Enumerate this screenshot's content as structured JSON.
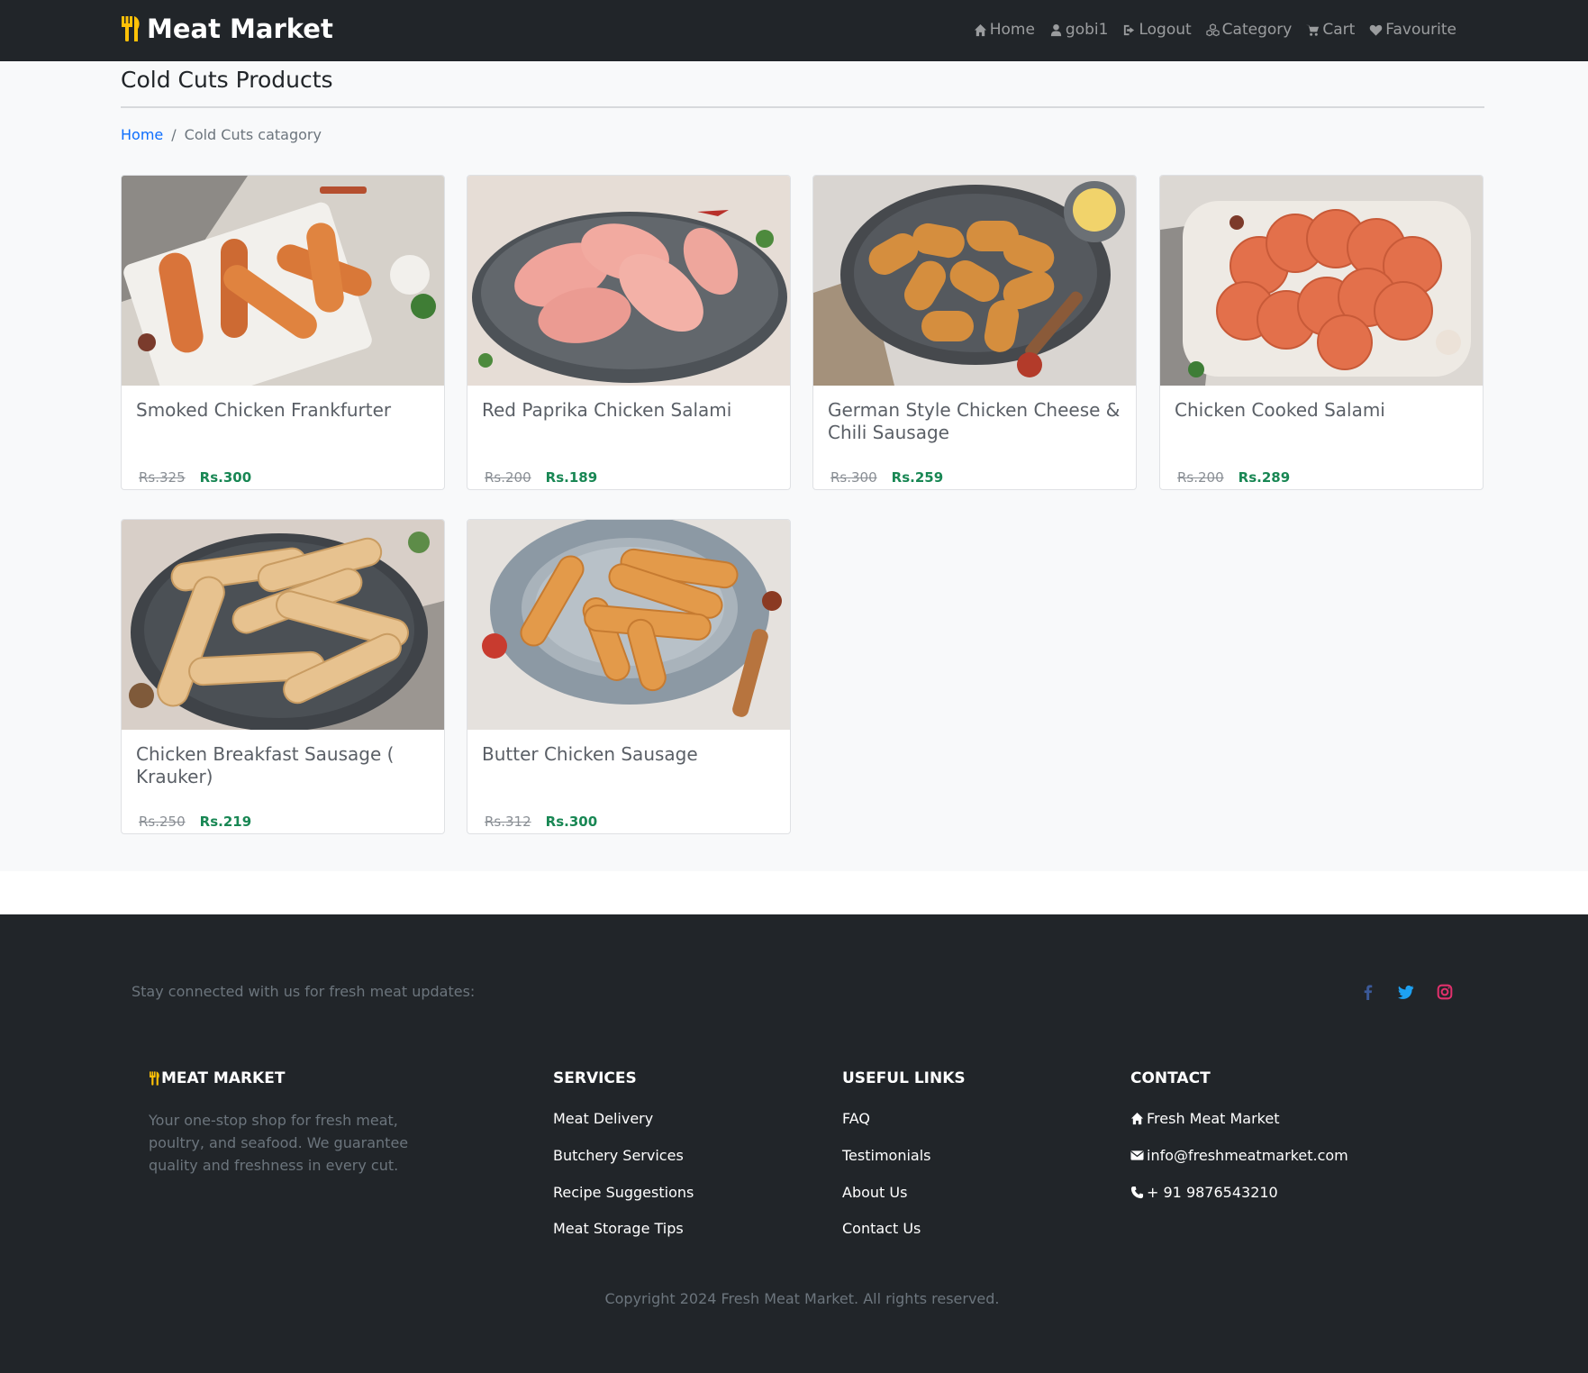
{
  "nav": {
    "brand": "Meat Market",
    "brand_icon": "utensils-icon",
    "links": [
      {
        "label": "Home",
        "icon": "home-icon"
      },
      {
        "label": "gobi1",
        "icon": "user-icon"
      },
      {
        "label": "Logout",
        "icon": "sign-out-icon"
      },
      {
        "label": "Category",
        "icon": "cubes-icon"
      },
      {
        "label": "Cart",
        "icon": "cart-icon"
      },
      {
        "label": "Favourite",
        "icon": "heart-icon"
      }
    ]
  },
  "page": {
    "title": "Cold Cuts Products",
    "breadcrumb": {
      "home": "Home",
      "separator": "/",
      "current": "Cold Cuts catagory"
    }
  },
  "products": [
    {
      "name": "Smoked Chicken Frankfurter",
      "old_price": "Rs.325",
      "price": "Rs.300",
      "image": "frankfurters on white board"
    },
    {
      "name": "Red Paprika Chicken Salami",
      "old_price": "Rs.200",
      "price": "Rs.189",
      "image": "pink salami slices on slate"
    },
    {
      "name": "German Style Chicken Cheese & Chili Sausage",
      "old_price": "Rs.300",
      "price": "Rs.259",
      "image": "short sausages on dark plate"
    },
    {
      "name": "Chicken Cooked Salami",
      "old_price": "Rs.200",
      "price": "Rs.289",
      "image": "salami slices on marble board"
    },
    {
      "name": "Chicken Breakfast Sausage ( Krauker)",
      "old_price": "Rs.250",
      "price": "Rs.219",
      "image": "pale sausages on dark plate"
    },
    {
      "name": "Butter Chicken Sausage",
      "old_price": "Rs.312",
      "price": "Rs.300",
      "image": "sausages on grey plate"
    }
  ],
  "footer": {
    "stay_connected": "Stay connected with us for fresh meat updates:",
    "social": [
      {
        "icon": "facebook-icon",
        "color": "#3b5998"
      },
      {
        "icon": "twitter-icon",
        "color": "#1da1f2"
      },
      {
        "icon": "instagram-icon",
        "color": "#e1306c"
      }
    ],
    "about": {
      "heading": "MEAT MARKET",
      "text": "Your one-stop shop for fresh meat, poultry, and seafood. We guarantee quality and freshness in every cut."
    },
    "services": {
      "heading": "SERVICES",
      "items": [
        "Meat Delivery",
        "Butchery Services",
        "Recipe Suggestions",
        "Meat Storage Tips"
      ]
    },
    "useful_links": {
      "heading": "USEFUL LINKS",
      "items": [
        "FAQ",
        "Testimonials",
        "About Us",
        "Contact Us"
      ]
    },
    "contact": {
      "heading": "CONTACT",
      "name": "Fresh Meat Market",
      "email": "info@freshmeatmarket.com",
      "phone": "+ 91 9876543210"
    },
    "copyright": "Copyright 2024 Fresh Meat Market. All rights reserved."
  },
  "colors": {
    "brand_icon": "#ffc107",
    "link": "#0d6efd",
    "price": "#198754",
    "dark": "#212529"
  }
}
